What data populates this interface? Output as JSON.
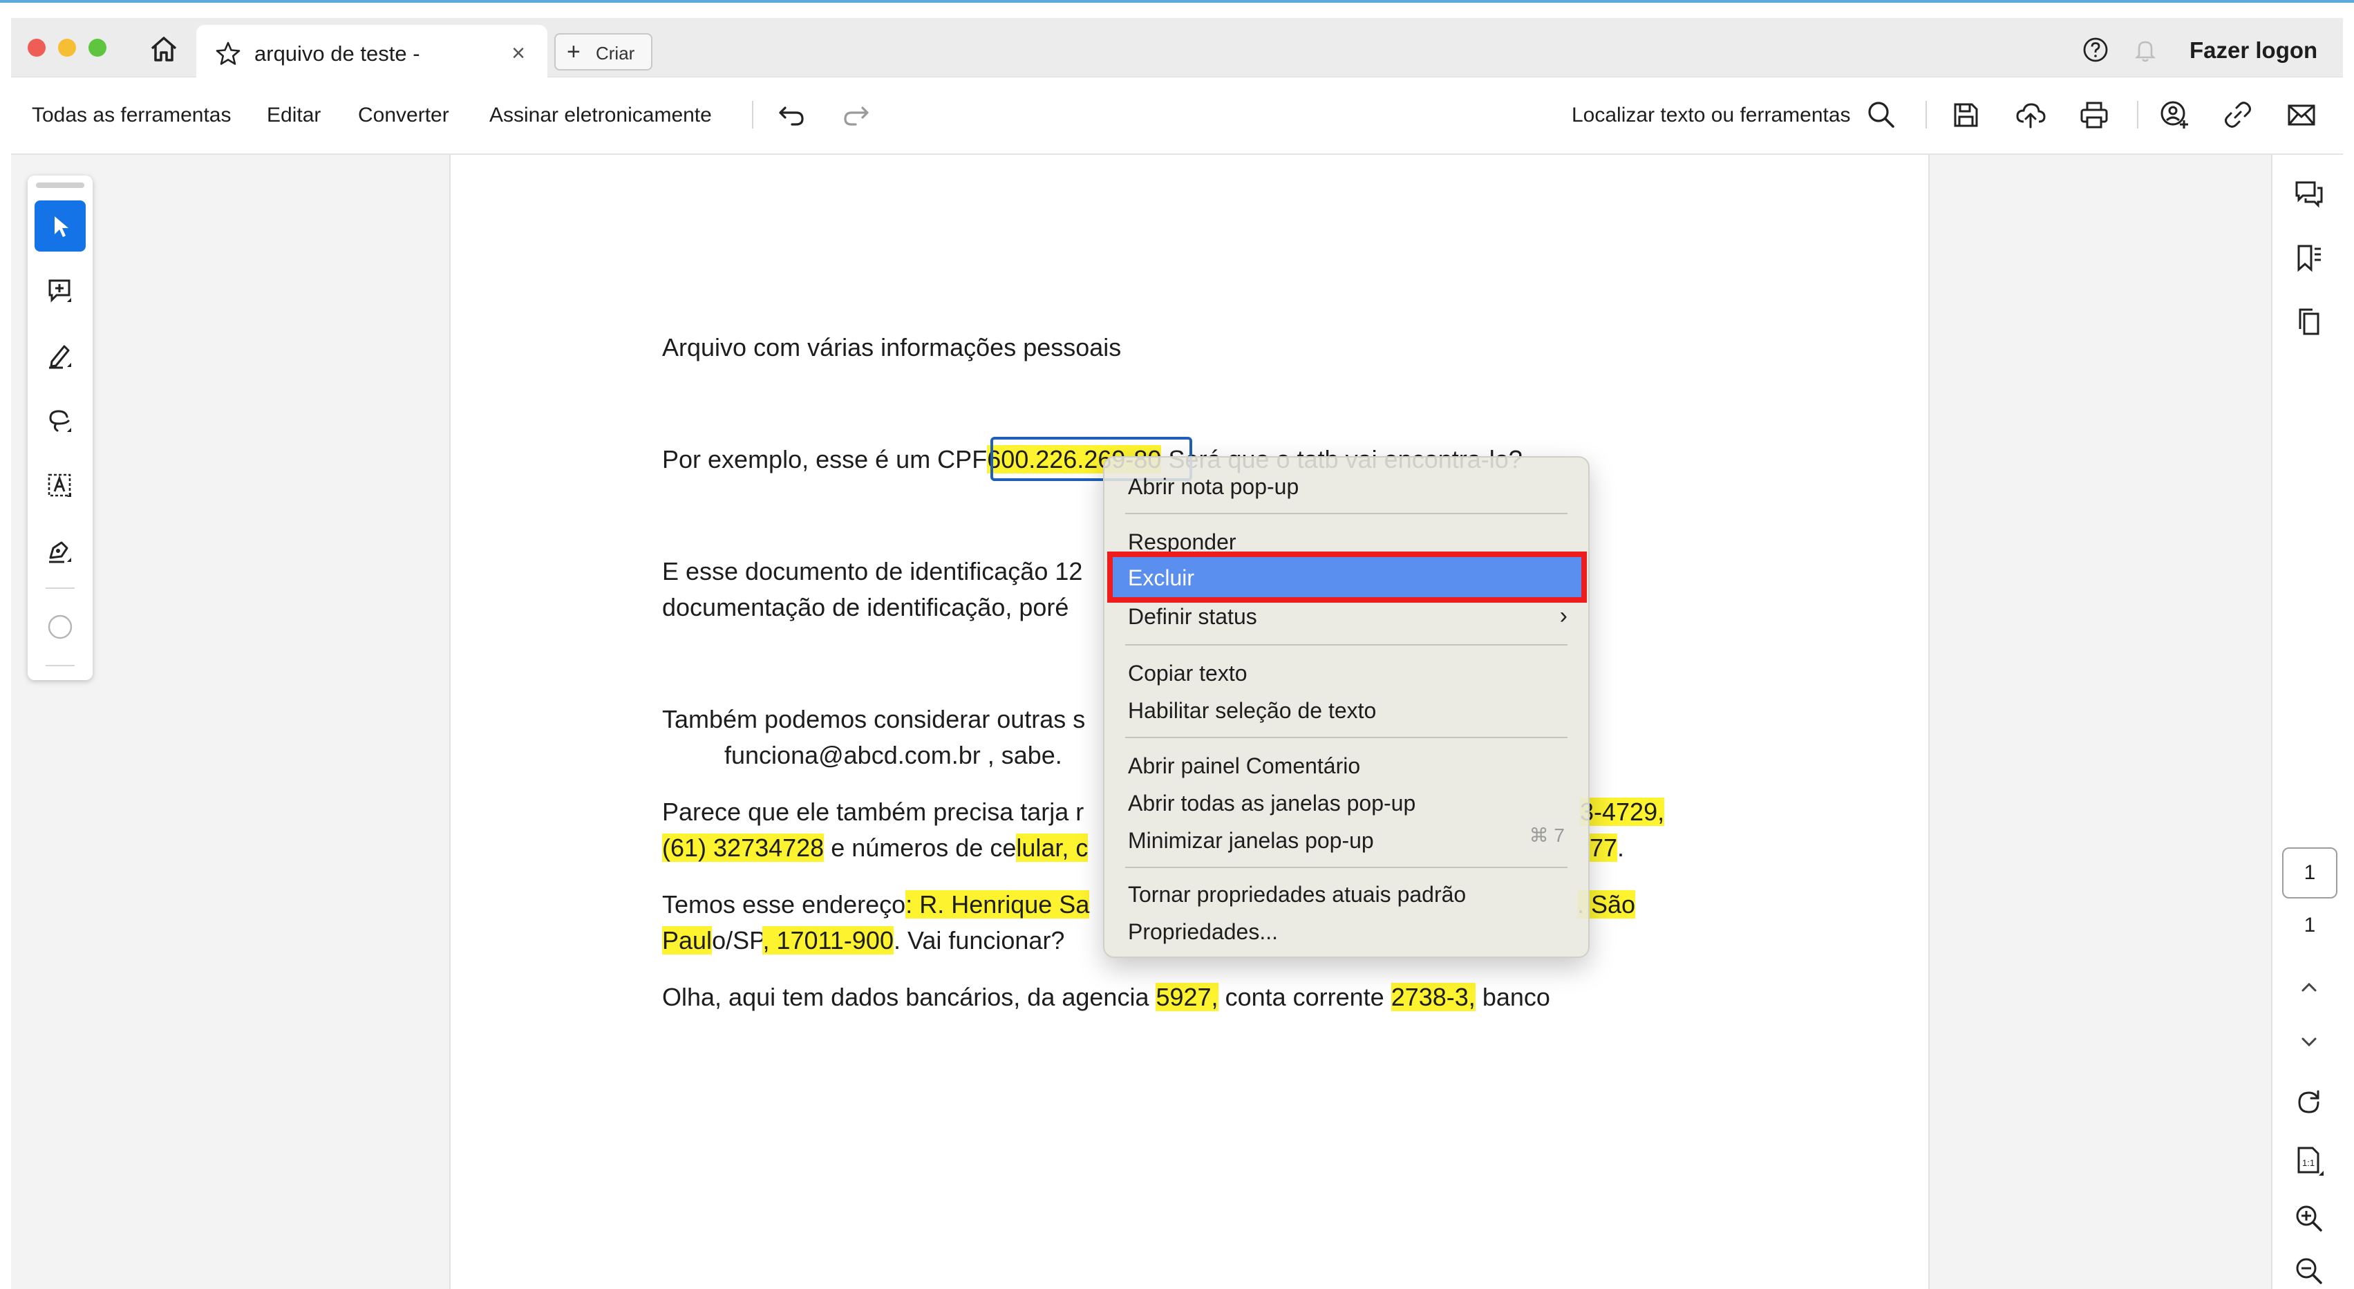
{
  "window": {
    "tab_title": "arquivo de teste -",
    "tab_close": "×",
    "create_label": "Criar",
    "login_label": "Fazer logon"
  },
  "toolbar": {
    "all_tools": "Todas as ferramentas",
    "edit": "Editar",
    "convert": "Converter",
    "sign": "Assinar eletronicamente",
    "search_label": "Localizar texto ou ferramentas"
  },
  "document": {
    "line1": "Arquivo com várias informações pessoais",
    "cpf_prefix": "Por exemplo, esse é um CPF",
    "cpf_value": "600.226.",
    "cpf_value_rest": "269-80",
    "cpf_suffix": " Será que o tatb vai encontra-lo?",
    "line3a": "E esse documento de identificação 12",
    "line3b": "documentação de identificação, poré",
    "line4a": "Também podemos considerar outras s",
    "line4b": "funciona@abcd.com.br , sabe.",
    "line5a": "Parece que ele também precisa tarja r",
    "line5a_tail": "3-4729,",
    "line5b_hl": "(61) 32734728",
    "line5b": " e números de ce",
    "line5b_hl2": "lular, c",
    "line5b_tail": "77",
    "line5b_dot": ".",
    "line6a": "Temos esse endereço",
    "line6a_hl": ": R. Henrique Sa",
    "line6a_tail": ". São",
    "line6b_hl": "Paul",
    "line6b": "o/SP",
    "line6b_hl2": ", 17011-900",
    "line6b_end": ". Vai funcionar?",
    "line7a": "Olha, aqui tem dados bancários, da agencia ",
    "line7_hl1": "5927,",
    "line7b": " conta corrente ",
    "line7_hl2": "2738-3,",
    "line7c": " banco"
  },
  "context_menu": {
    "items": [
      "Abrir nota pop-up",
      "Responder",
      "Excluir",
      "Definir status",
      "Copiar texto",
      "Habilitar seleção de texto",
      "Abrir painel Comentário",
      "Abrir todas as janelas pop-up",
      "Minimizar janelas pop-up",
      "Tornar propriedades atuais padrão",
      "Propriedades..."
    ],
    "submenu_arrow": "›",
    "minimize_shortcut": "⌘ 7",
    "highlighted_item": "Excluir"
  },
  "pagination": {
    "current": "1",
    "total": "1"
  },
  "colors": {
    "highlight": "#fdf32f",
    "menu_highlight": "#5a8ff0",
    "callout": "#ee1c1c",
    "accent": "#1473e6"
  }
}
